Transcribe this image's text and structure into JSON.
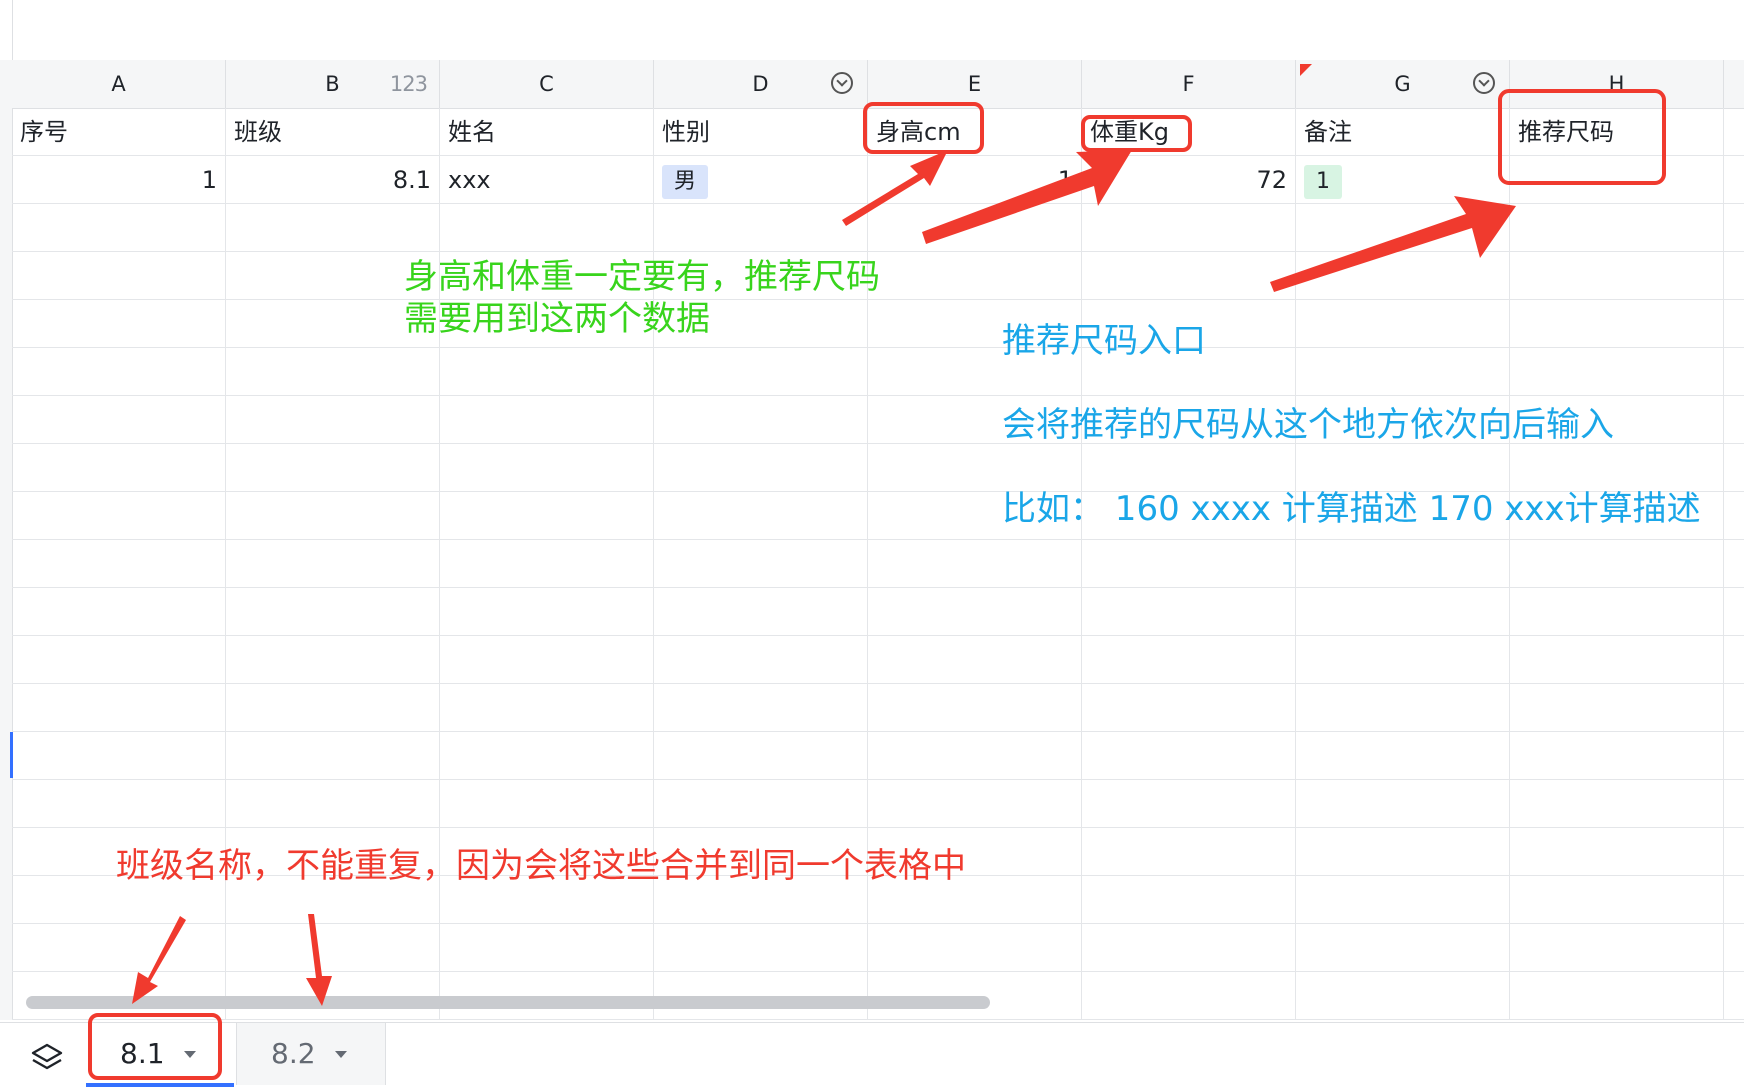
{
  "columns": [
    {
      "letter": "A",
      "badge": "",
      "filter": false
    },
    {
      "letter": "B",
      "badge": "123",
      "filter": false
    },
    {
      "letter": "C",
      "badge": "",
      "filter": false
    },
    {
      "letter": "D",
      "badge": "",
      "filter": true
    },
    {
      "letter": "E",
      "badge": "",
      "filter": false
    },
    {
      "letter": "F",
      "badge": "",
      "filter": false
    },
    {
      "letter": "G",
      "badge": "",
      "filter": true
    },
    {
      "letter": "H",
      "badge": "",
      "filter": false
    }
  ],
  "header_row": [
    "序号",
    "班级",
    "姓名",
    "性别",
    "身高cm",
    "体重Kg",
    "备注",
    "推荐尺码"
  ],
  "data_rows": [
    [
      "1",
      "8.1",
      "xxx",
      "男",
      "1",
      "72",
      "1",
      ""
    ]
  ],
  "sheet_tabs": [
    {
      "label": "8.1",
      "active": true
    },
    {
      "label": "8.2",
      "active": false
    }
  ],
  "annotations": {
    "height_weight_line1": "身高和体重一定要有，推荐尺码",
    "height_weight_line2": "需要用到这两个数据",
    "entry_title": "推荐尺码入口",
    "entry_desc": "会将推荐的尺码从这个地方依次向后输入",
    "entry_example": "比如： 160 xxxx 计算描述 170 xxx计算描述",
    "class_name_note": "班级名称，不能重复，因为会将这些合并到同一个表格中"
  },
  "colors": {
    "annotation_red": "#f03a2e",
    "annotation_green": "#38d41c",
    "annotation_blue": "#1aa6e8",
    "selection_blue": "#3370ff"
  }
}
